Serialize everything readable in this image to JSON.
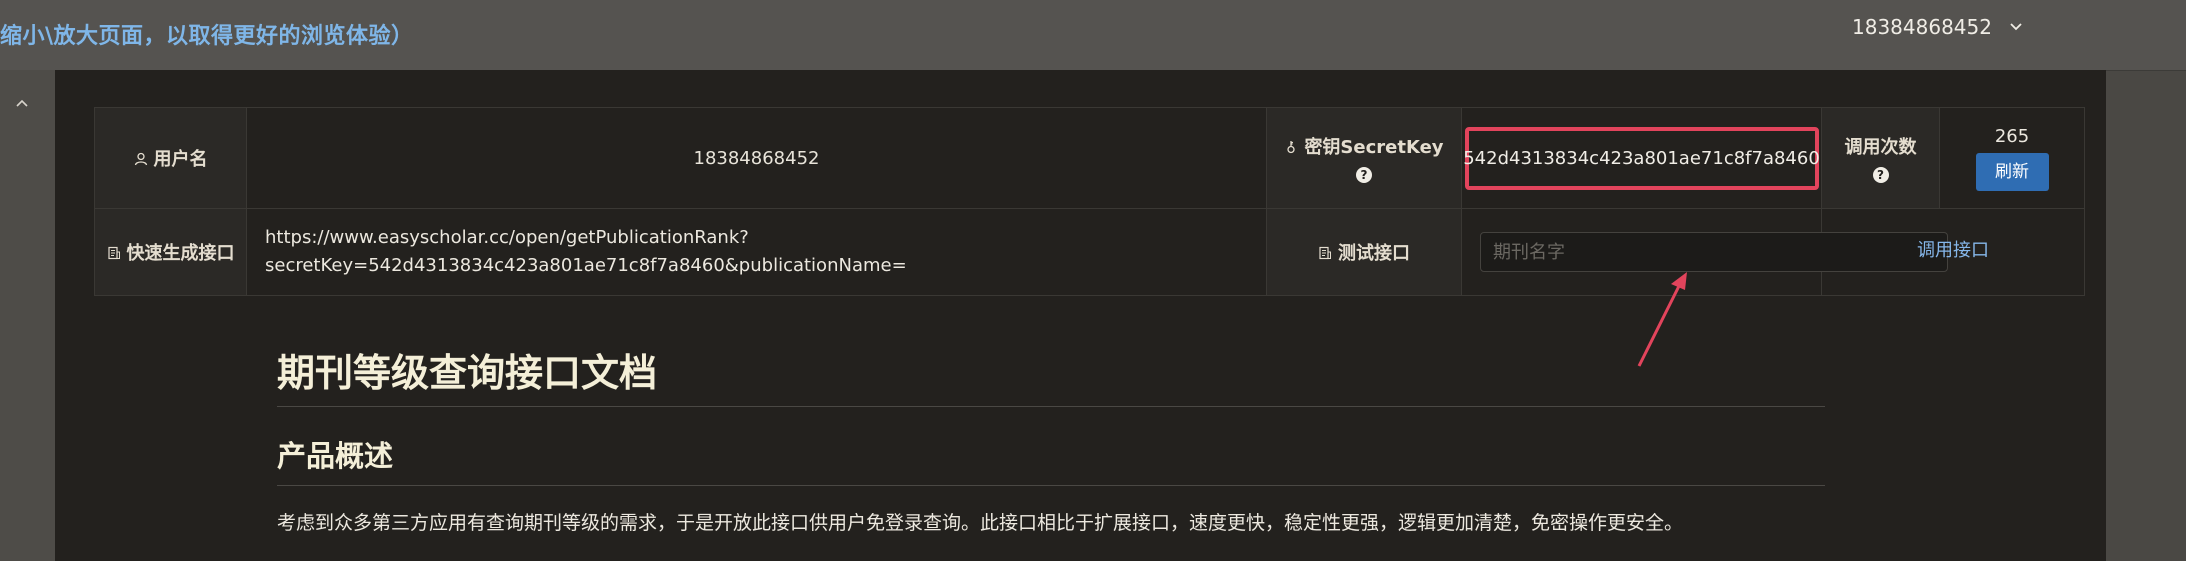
{
  "header": {
    "notice": "缩小\\放大页面，以取得更好的浏览体验）",
    "username": "18384868452",
    "dropdown_icon": "chevron-down-icon"
  },
  "sidebar": {
    "collapse_icon": "chevron-up-icon"
  },
  "info_table": {
    "username_label": "用户名",
    "username_value": "18384868452",
    "secret_label": "密钥SecretKey",
    "secret_help": "?",
    "secret_value": "542d4313834c423a801ae71c8f7a8460",
    "calls_label": "调用次数",
    "calls_help": "?",
    "calls_value": "265",
    "refresh_label": "刷新",
    "quick_label": "快速生成接口",
    "quick_url_line1": "https://www.easyscholar.cc/open/getPublicationRank?",
    "quick_url_line2": "secretKey=542d4313834c423a801ae71c8f7a8460&publicationName=",
    "test_label": "测试接口",
    "test_placeholder": "期刊名字",
    "call_link": "调用接口"
  },
  "doc": {
    "title": "期刊等级查询接口文档",
    "section_title": "产品概述",
    "intro": "考虑到众多第三方应用有查询期刊等级的需求，于是开放此接口供用户免登录查询。此接口相比于扩展接口，速度更快，稳定性更强，逻辑更加清楚，免密操作更安全。"
  },
  "colors": {
    "highlight_border": "#e2445c",
    "refresh_button": "#2f6db3",
    "link": "#86b7ea",
    "notice": "#7fb6e8"
  }
}
